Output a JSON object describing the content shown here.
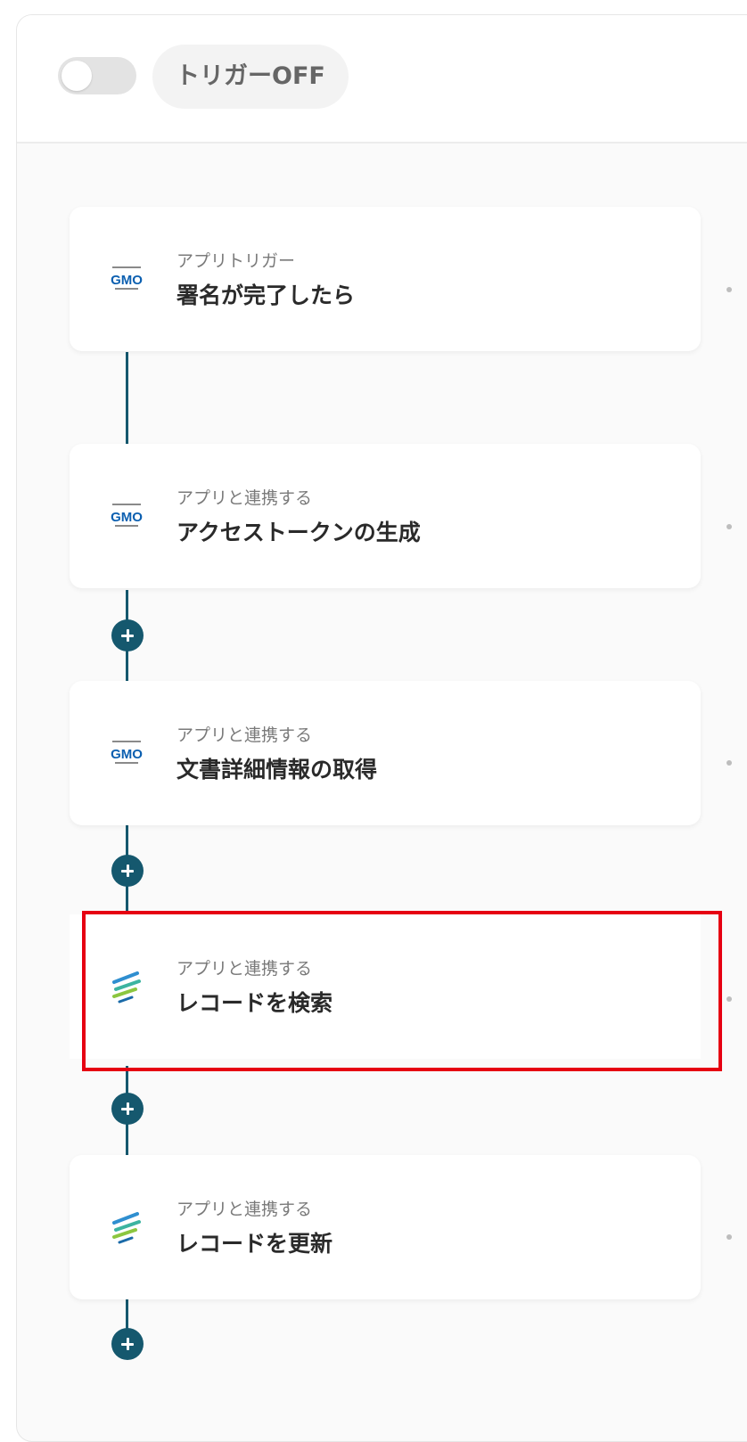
{
  "header": {
    "trigger_status_label": "トリガーOFF"
  },
  "flow": {
    "steps": [
      {
        "subtitle": "アプリトリガー",
        "title": "署名が完了したら",
        "app_icon": "gmo-sign-icon"
      },
      {
        "subtitle": "アプリと連携する",
        "title": "アクセストークンの生成",
        "app_icon": "gmo-sign-icon"
      },
      {
        "subtitle": "アプリと連携する",
        "title": "文書詳細情報の取得",
        "app_icon": "gmo-sign-icon"
      },
      {
        "subtitle": "アプリと連携する",
        "title": "レコードを検索",
        "app_icon": "kintone-icon",
        "selected": true
      },
      {
        "subtitle": "アプリと連携する",
        "title": "レコードを更新",
        "app_icon": "kintone-icon"
      }
    ]
  },
  "colors": {
    "connector": "#15586e",
    "highlight": "#e60012",
    "toggle_off": "#e3e3e3"
  }
}
